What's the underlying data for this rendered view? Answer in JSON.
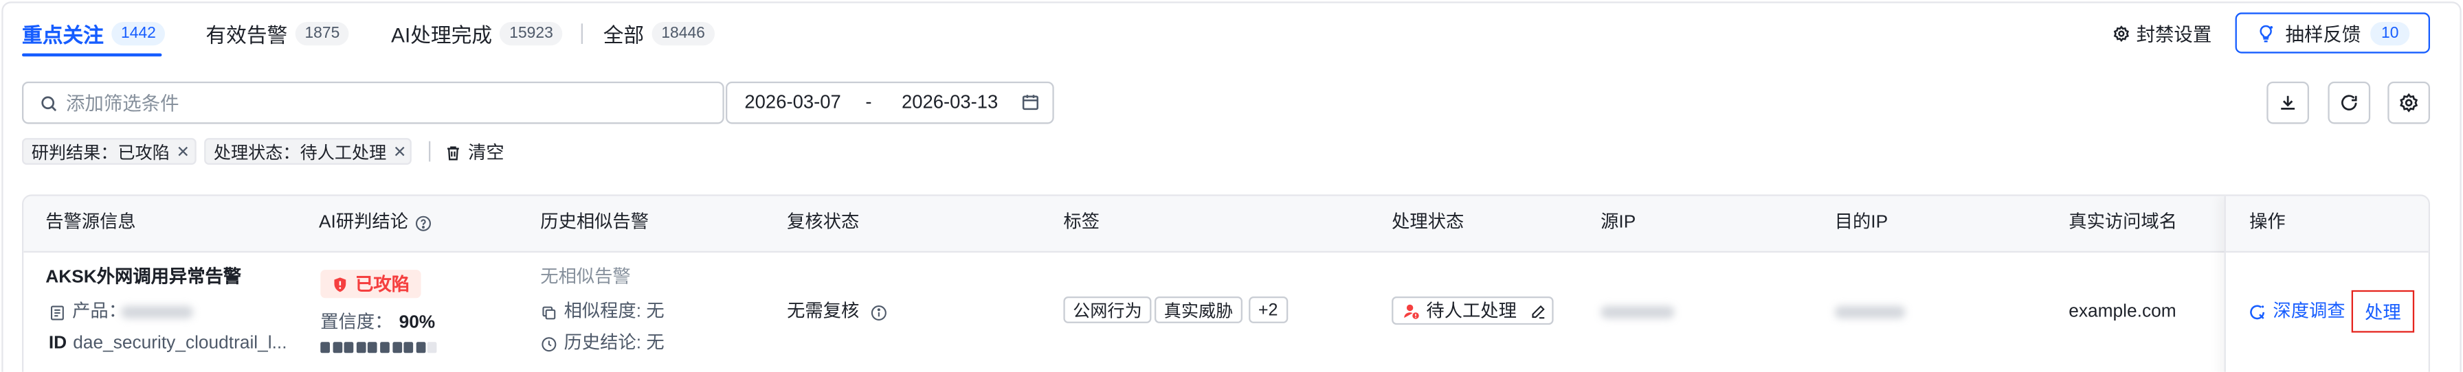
{
  "tabs": [
    {
      "label": "重点关注",
      "count": "1442",
      "active": true
    },
    {
      "label": "有效告警",
      "count": "1875",
      "active": false
    },
    {
      "label": "AI处理完成",
      "count": "15923",
      "active": false
    },
    {
      "label": "全部",
      "count": "18446",
      "active": false
    }
  ],
  "toolbar": {
    "ban_settings": "封禁设置",
    "feedback": {
      "label": "抽样反馈",
      "count": "10"
    },
    "icons": [
      "download-icon",
      "refresh-icon",
      "settings-icon"
    ]
  },
  "search": {
    "placeholder": "添加筛选条件"
  },
  "date_range": {
    "start": "2026-03-07",
    "separator": "-",
    "end": "2026-03-13"
  },
  "filters": {
    "chips": [
      "研判结果：已攻陷",
      "处理状态：待人工处理"
    ],
    "clear": "清空"
  },
  "table": {
    "columns": [
      "告警源信息",
      "AI研判结论",
      "历史相似告警",
      "复核状态",
      "标签",
      "处理状态",
      "源IP",
      "目的IP",
      "真实访问域名",
      "操作"
    ],
    "rows": [
      {
        "alert_name": "AKSK外网调用异常告警",
        "product_label": "产品：",
        "id_label": "ID",
        "id_value": "dae_security_cloudtrail_l...",
        "verdict": "已攻陷",
        "confidence_label": "置信度：",
        "confidence": "90%",
        "confidence_fraction": 0.9,
        "similar_summary": "无相似告警",
        "similarity": "相似程度: 无",
        "history_conclusion": "历史结论: 无",
        "review_status": "无需复核",
        "tags": [
          "公网行为",
          "真实威胁",
          "+2"
        ],
        "handling_status": "待人工处理",
        "real_domain": "example.com",
        "actions": {
          "investigate": "深度调查",
          "handle": "处理"
        }
      }
    ]
  },
  "colors": {
    "primary": "#165dff",
    "danger": "#f53f3f",
    "danger_bg": "#ffece8",
    "highlight_box": "#e5251f"
  }
}
